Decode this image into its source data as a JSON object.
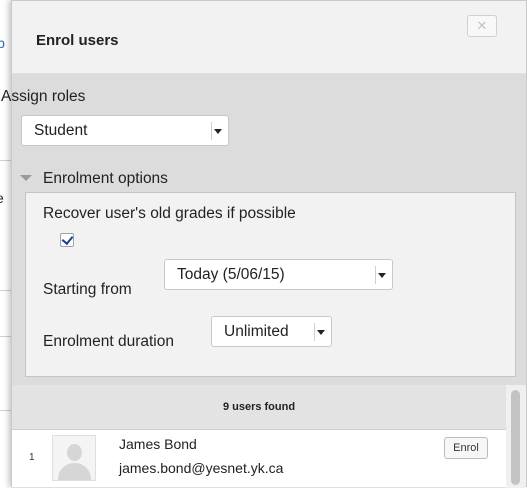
{
  "background": {
    "fragment_top": "lb",
    "fragment_middle": "e"
  },
  "dialog": {
    "title": "Enrol users",
    "close_glyph": "✕"
  },
  "roles": {
    "assign_label": "Assign roles",
    "role_selected": "Student"
  },
  "enrolment_options": {
    "legend": "Enrolment options",
    "recover_grades_label": "Recover user's old grades if possible",
    "recover_grades_checked": true,
    "starting_from_label": "Starting from",
    "starting_from_value": "Today (5/06/15)",
    "duration_label": "Enrolment duration",
    "duration_value": "Unlimited"
  },
  "users": {
    "found_text": "9 users found",
    "rows": [
      {
        "index": "1",
        "name": "James Bond",
        "email": "james.bond@yesnet.yk.ca",
        "action_label": "Enrol"
      }
    ]
  },
  "icons": {
    "close": "close-icon",
    "collapse": "triangle-down-icon",
    "avatar": "user-avatar-placeholder",
    "dropdown": "chevron-down-icon"
  }
}
